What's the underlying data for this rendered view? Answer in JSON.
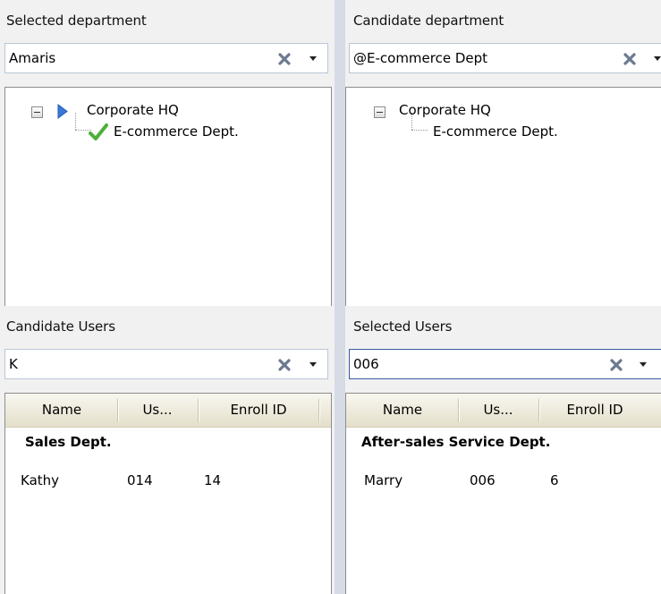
{
  "panels": {
    "selected_department": {
      "title": "Selected department",
      "search_value": "Amaris",
      "tree": {
        "root": "Corporate HQ",
        "child": "E-commerce Dept."
      }
    },
    "candidate_department": {
      "title": "Candidate department",
      "search_value": "@E-commerce Dept",
      "tree": {
        "root": "Corporate HQ",
        "child": "E-commerce Dept."
      }
    },
    "candidate_users": {
      "title": "Candidate Users",
      "search_value": "K",
      "columns": [
        "Name",
        "Us...",
        "Enroll ID"
      ],
      "group": "Sales Dept.",
      "rows": [
        {
          "name": "Kathy",
          "user_id": "014",
          "enroll_id": "14"
        }
      ]
    },
    "selected_users": {
      "title": "Selected Users",
      "search_value": "006",
      "columns": [
        "Name",
        "Us...",
        "Enroll ID"
      ],
      "group": "After-sales Service Dept.",
      "rows": [
        {
          "name": "Marry",
          "user_id": "006",
          "enroll_id": "6"
        }
      ]
    }
  },
  "icons": {
    "clear": "close-x-icon",
    "dropdown": "chevron-down-icon",
    "collapse": "minus-box-icon",
    "selected_node": "triangle-right-icon",
    "checked": "check-icon"
  },
  "colors": {
    "background": "#d6dbe6",
    "panel": "#f1f1f1",
    "selected_node_arrow": "#3a78d4",
    "check": "#4caf3a",
    "focused_border": "#3a5aa8"
  }
}
